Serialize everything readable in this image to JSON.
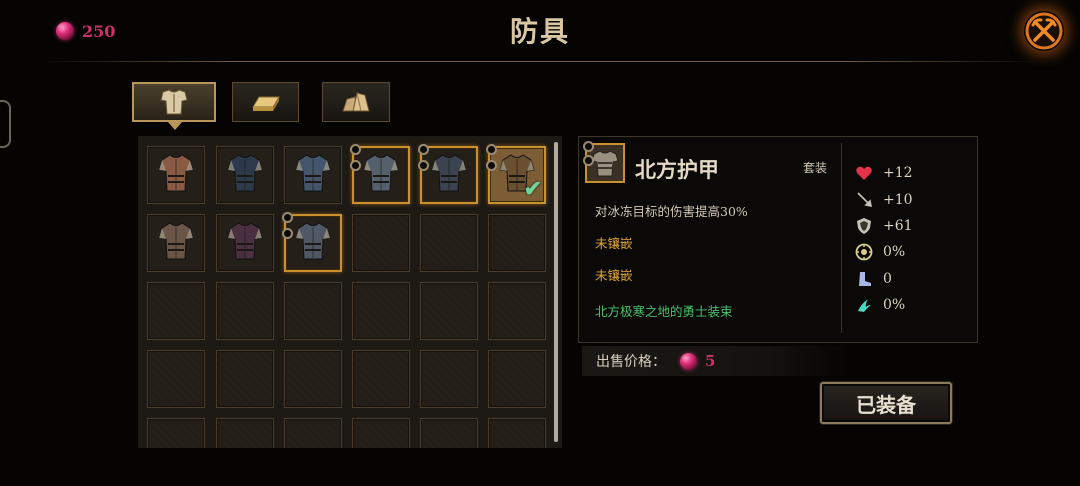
{
  "header": {
    "title": "防具",
    "currency_value": "250",
    "close_icon": "close-crossed-axes-icon"
  },
  "tabs": [
    {
      "name": "armor-chest",
      "icon": "chest-armor-icon",
      "active": true
    },
    {
      "name": "ingot",
      "icon": "ingot-icon",
      "active": false
    },
    {
      "name": "crystal",
      "icon": "crystal-ore-icon",
      "active": false
    }
  ],
  "inventory": {
    "rows": [
      [
        {
          "item": "leather-armor",
          "color": "#8a5a44"
        },
        {
          "item": "blue-plate-armor",
          "color": "#2d3a4c"
        },
        {
          "item": "spiked-plate-armor",
          "color": "#45566c"
        },
        {
          "item": "riveted-armor",
          "color": "#54606c",
          "legendary": true,
          "sockets": 2
        },
        {
          "item": "dark-plate-armor",
          "color": "#3b4350",
          "legendary": true,
          "sockets": 2
        },
        {
          "item": "northern-armor",
          "color": "#6a5030",
          "legendary": true,
          "sockets": 2,
          "selected": true,
          "equipped": true
        }
      ],
      [
        {
          "item": "steel-leather-armor",
          "color": "#6b5546"
        },
        {
          "item": "robed-armor",
          "color": "#4a3040"
        },
        {
          "item": "steel-cuirass",
          "color": "#505866",
          "legendary": true,
          "sockets": 2
        },
        null,
        null,
        null
      ],
      [
        null,
        null,
        null,
        null,
        null,
        null
      ],
      [
        null,
        null,
        null,
        null,
        null,
        null
      ],
      [
        null,
        null,
        null,
        null,
        null,
        null
      ]
    ]
  },
  "detail": {
    "name": "北方护甲",
    "set_label": "套装",
    "effect": "对冰冻目标的伤害提高30%",
    "socket_1": "未镶嵌",
    "socket_2": "未镶嵌",
    "set_desc": "北方极寒之地的勇士装束",
    "stats": [
      {
        "icon": "heart-icon",
        "value": "+12",
        "color": "#e0334a"
      },
      {
        "icon": "sword-icon",
        "value": "+10",
        "color": "#c8c2b8"
      },
      {
        "icon": "shield-icon",
        "value": "+61",
        "color": "#c8c2b8"
      },
      {
        "icon": "crit-target-icon",
        "value": "0%",
        "color": "#d8cc90"
      },
      {
        "icon": "boot-icon",
        "value": "0",
        "color": "#a9b7e8"
      },
      {
        "icon": "leech-claw-icon",
        "value": "0%",
        "color": "#4fd6c6"
      }
    ]
  },
  "sell": {
    "label": "出售价格：",
    "value": "5"
  },
  "equip_button": "已装备"
}
